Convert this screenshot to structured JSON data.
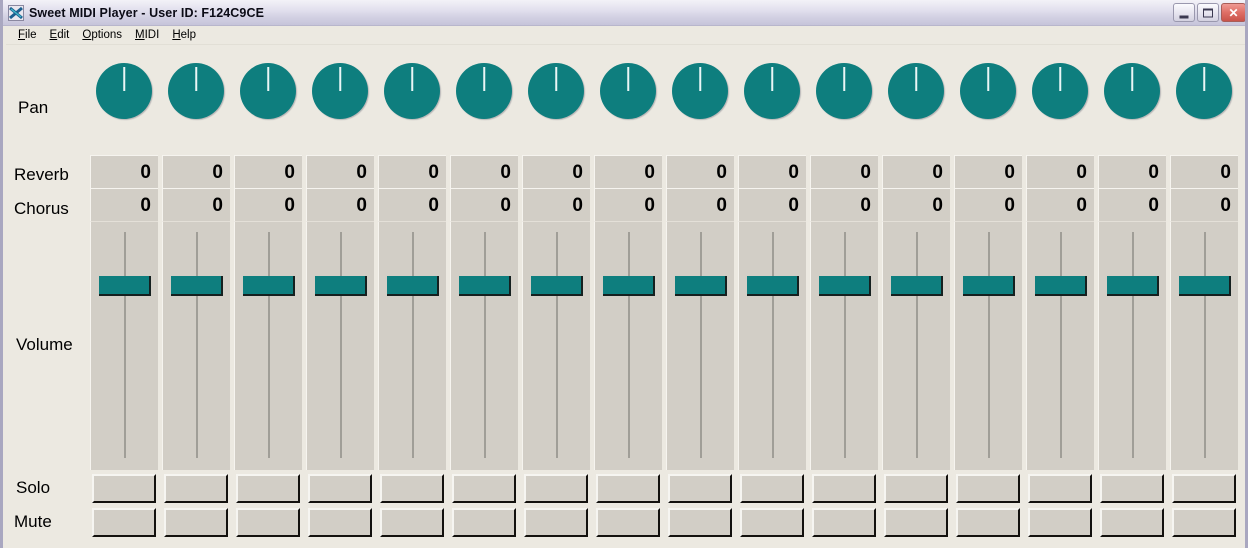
{
  "window": {
    "title": "Sweet MIDI Player - User ID: F124C9CE",
    "app_icon": "midi-app-icon",
    "controls": {
      "minimize": "minimize-button",
      "maximize": "maximize-button",
      "close": "close-button",
      "close_glyph": "✕"
    }
  },
  "menu": {
    "items": [
      {
        "label": "File",
        "accel": "F"
      },
      {
        "label": "Edit",
        "accel": "E"
      },
      {
        "label": "Options",
        "accel": "O"
      },
      {
        "label": "MIDI",
        "accel": "M"
      },
      {
        "label": "Help",
        "accel": "H"
      }
    ]
  },
  "mixer": {
    "row_labels": {
      "pan": "Pan",
      "reverb": "Reverb",
      "chorus": "Chorus",
      "volume": "Volume",
      "solo": "Solo",
      "mute": "Mute"
    },
    "channel_count": 16,
    "colors": {
      "accent_teal": "#0e7e7e",
      "panel_face": "#d2cec6",
      "window_face": "#ece9e1",
      "titlebar": "#d2d0e2",
      "close_red": "#c9534a"
    },
    "channels": [
      {
        "index": 1,
        "pan": 64,
        "pan_angle": 0,
        "reverb": "0",
        "chorus": "0",
        "volume": 100,
        "solo": false,
        "mute": false
      },
      {
        "index": 2,
        "pan": 64,
        "pan_angle": 0,
        "reverb": "0",
        "chorus": "0",
        "volume": 100,
        "solo": false,
        "mute": false
      },
      {
        "index": 3,
        "pan": 64,
        "pan_angle": 0,
        "reverb": "0",
        "chorus": "0",
        "volume": 100,
        "solo": false,
        "mute": false
      },
      {
        "index": 4,
        "pan": 64,
        "pan_angle": 0,
        "reverb": "0",
        "chorus": "0",
        "volume": 100,
        "solo": false,
        "mute": false
      },
      {
        "index": 5,
        "pan": 64,
        "pan_angle": 0,
        "reverb": "0",
        "chorus": "0",
        "volume": 100,
        "solo": false,
        "mute": false
      },
      {
        "index": 6,
        "pan": 64,
        "pan_angle": 0,
        "reverb": "0",
        "chorus": "0",
        "volume": 100,
        "solo": false,
        "mute": false
      },
      {
        "index": 7,
        "pan": 64,
        "pan_angle": 0,
        "reverb": "0",
        "chorus": "0",
        "volume": 100,
        "solo": false,
        "mute": false
      },
      {
        "index": 8,
        "pan": 64,
        "pan_angle": 0,
        "reverb": "0",
        "chorus": "0",
        "volume": 100,
        "solo": false,
        "mute": false
      },
      {
        "index": 9,
        "pan": 64,
        "pan_angle": 0,
        "reverb": "0",
        "chorus": "0",
        "volume": 100,
        "solo": false,
        "mute": false
      },
      {
        "index": 10,
        "pan": 64,
        "pan_angle": 0,
        "reverb": "0",
        "chorus": "0",
        "volume": 100,
        "solo": false,
        "mute": false
      },
      {
        "index": 11,
        "pan": 64,
        "pan_angle": 0,
        "reverb": "0",
        "chorus": "0",
        "volume": 100,
        "solo": false,
        "mute": false
      },
      {
        "index": 12,
        "pan": 64,
        "pan_angle": 0,
        "reverb": "0",
        "chorus": "0",
        "volume": 100,
        "solo": false,
        "mute": false
      },
      {
        "index": 13,
        "pan": 64,
        "pan_angle": 0,
        "reverb": "0",
        "chorus": "0",
        "volume": 100,
        "solo": false,
        "mute": false
      },
      {
        "index": 14,
        "pan": 64,
        "pan_angle": 0,
        "reverb": "0",
        "chorus": "0",
        "volume": 100,
        "solo": false,
        "mute": false
      },
      {
        "index": 15,
        "pan": 64,
        "pan_angle": 0,
        "reverb": "0",
        "chorus": "0",
        "volume": 100,
        "solo": false,
        "mute": false
      },
      {
        "index": 16,
        "pan": 64,
        "pan_angle": 0,
        "reverb": "0",
        "chorus": "0",
        "volume": 100,
        "solo": false,
        "mute": false
      }
    ]
  }
}
